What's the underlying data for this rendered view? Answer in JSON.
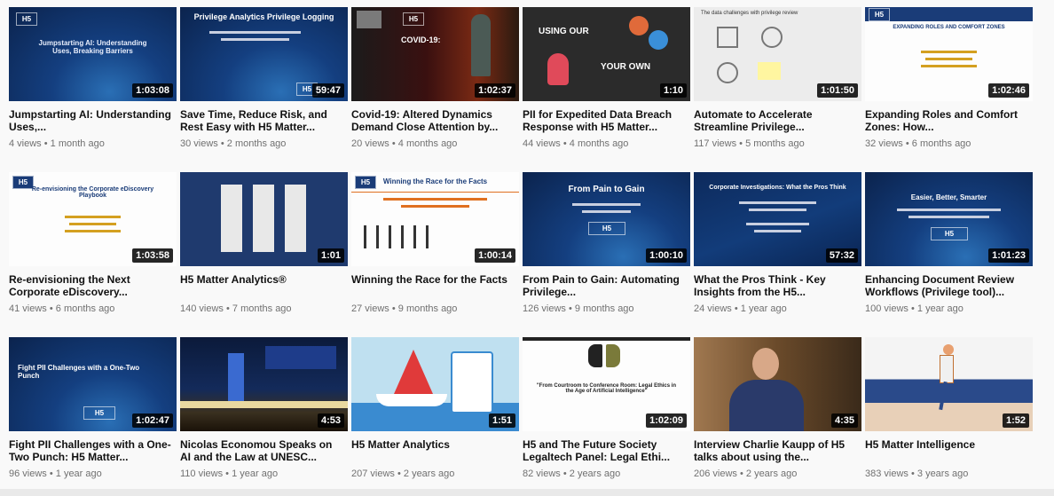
{
  "videos": [
    {
      "title": "Jumpstarting AI: Understanding Uses,...",
      "views": "4 views",
      "age": "1 month ago",
      "duration": "1:03:08",
      "thumb_text": "Jumpstarting AI: Understanding Uses, Breaking Barriers",
      "thumb_icon": "h5-logo"
    },
    {
      "title": "Save Time, Reduce Risk, and Rest Easy with H5 Matter...",
      "views": "30 views",
      "age": "2 months ago",
      "duration": "59:47",
      "thumb_text": "Privilege Analytics Privilege Logging",
      "thumb_icon": "h5-logo"
    },
    {
      "title": "Covid-19: Altered Dynamics Demand Close Attention by...",
      "views": "20 views",
      "age": "4 months ago",
      "duration": "1:02:37",
      "thumb_text": "COVID-19:",
      "thumb_icon": "statue"
    },
    {
      "title": "PII for Expedited Data Breach Response with H5 Matter...",
      "views": "44 views",
      "age": "4 months ago",
      "duration": "1:10",
      "thumb_text_top": "USING OUR",
      "thumb_text_bottom": "YOUR OWN",
      "thumb_icon": "people-icons"
    },
    {
      "title": "Automate to Accelerate Streamline Privilege...",
      "views": "117 views",
      "age": "5 months ago",
      "duration": "1:01:50",
      "thumb_text": "The data challenges with privilege review",
      "thumb_icon": "diagram-icons"
    },
    {
      "title": "Expanding Roles and Comfort Zones: How...",
      "views": "32 views",
      "age": "6 months ago",
      "duration": "1:02:46",
      "thumb_text": "EXPANDING ROLES AND COMFORT ZONES",
      "thumb_icon": "h5-logo"
    },
    {
      "title": "Re-envisioning the Next Corporate eDiscovery...",
      "views": "41 views",
      "age": "6 months ago",
      "duration": "1:03:58",
      "thumb_text": "Re-envisioning the Corporate eDiscovery Playbook",
      "thumb_icon": "h5-logo"
    },
    {
      "title": "H5 Matter Analytics®",
      "views": "140 views",
      "age": "7 months ago",
      "duration": "1:01",
      "thumb_icon": "document-columns"
    },
    {
      "title": "Winning the Race for the Facts",
      "views": "27 views",
      "age": "9 months ago",
      "duration": "1:00:14",
      "thumb_text": "Winning the Race for the Facts",
      "thumb_icon": "race-figures"
    },
    {
      "title": "From Pain to Gain: Automating Privilege...",
      "views": "126 views",
      "age": "9 months ago",
      "duration": "1:00:10",
      "thumb_text": "From Pain to Gain",
      "thumb_icon": "h5-logo"
    },
    {
      "title": "What the Pros Think - Key Insights from the H5...",
      "views": "24 views",
      "age": "1 year ago",
      "duration": "57:32",
      "thumb_text": "Corporate Investigations: What the Pros Think",
      "thumb_icon": "h5-logo"
    },
    {
      "title": "Enhancing Document Review Workflows (Privilege tool)...",
      "views": "100 views",
      "age": "1 year ago",
      "duration": "1:01:23",
      "thumb_text": "Easier, Better, Smarter",
      "thumb_icon": "h5-logo"
    },
    {
      "title": "Fight PII Challenges with a One-Two Punch: H5 Matter...",
      "views": "96 views",
      "age": "1 year ago",
      "duration": "1:02:47",
      "thumb_text": "Fight PII Challenges with a One-Two Punch",
      "thumb_icon": "h5-logo"
    },
    {
      "title": "Nicolas Economou Speaks on AI and the Law at UNESC...",
      "views": "110 views",
      "age": "1 year ago",
      "duration": "4:53",
      "thumb_icon": "conference-stage"
    },
    {
      "title": "H5 Matter Analytics",
      "views": "207 views",
      "age": "2 years ago",
      "duration": "1:51",
      "thumb_icon": "sailboat"
    },
    {
      "title": "H5 and The Future Society Legaltech Panel: Legal Ethi...",
      "views": "82 views",
      "age": "2 years ago",
      "duration": "1:02:09",
      "thumb_text": "\"From Courtroom to Conference Room: Legal Ethics in the Age of Artificial Intelligence\"",
      "thumb_icon": "faces"
    },
    {
      "title": "Interview Charlie Kaupp of H5 talks about using the...",
      "views": "206 views",
      "age": "2 years ago",
      "duration": "4:35",
      "thumb_icon": "person"
    },
    {
      "title": "H5 Matter Intelligence",
      "views": "383 views",
      "age": "3 years ago",
      "duration": "1:52",
      "thumb_icon": "walking-figure"
    }
  ],
  "colors": {
    "navy": "#123c7a",
    "duration_bg": "#000000",
    "meta": "#707070",
    "title": "#111111"
  }
}
